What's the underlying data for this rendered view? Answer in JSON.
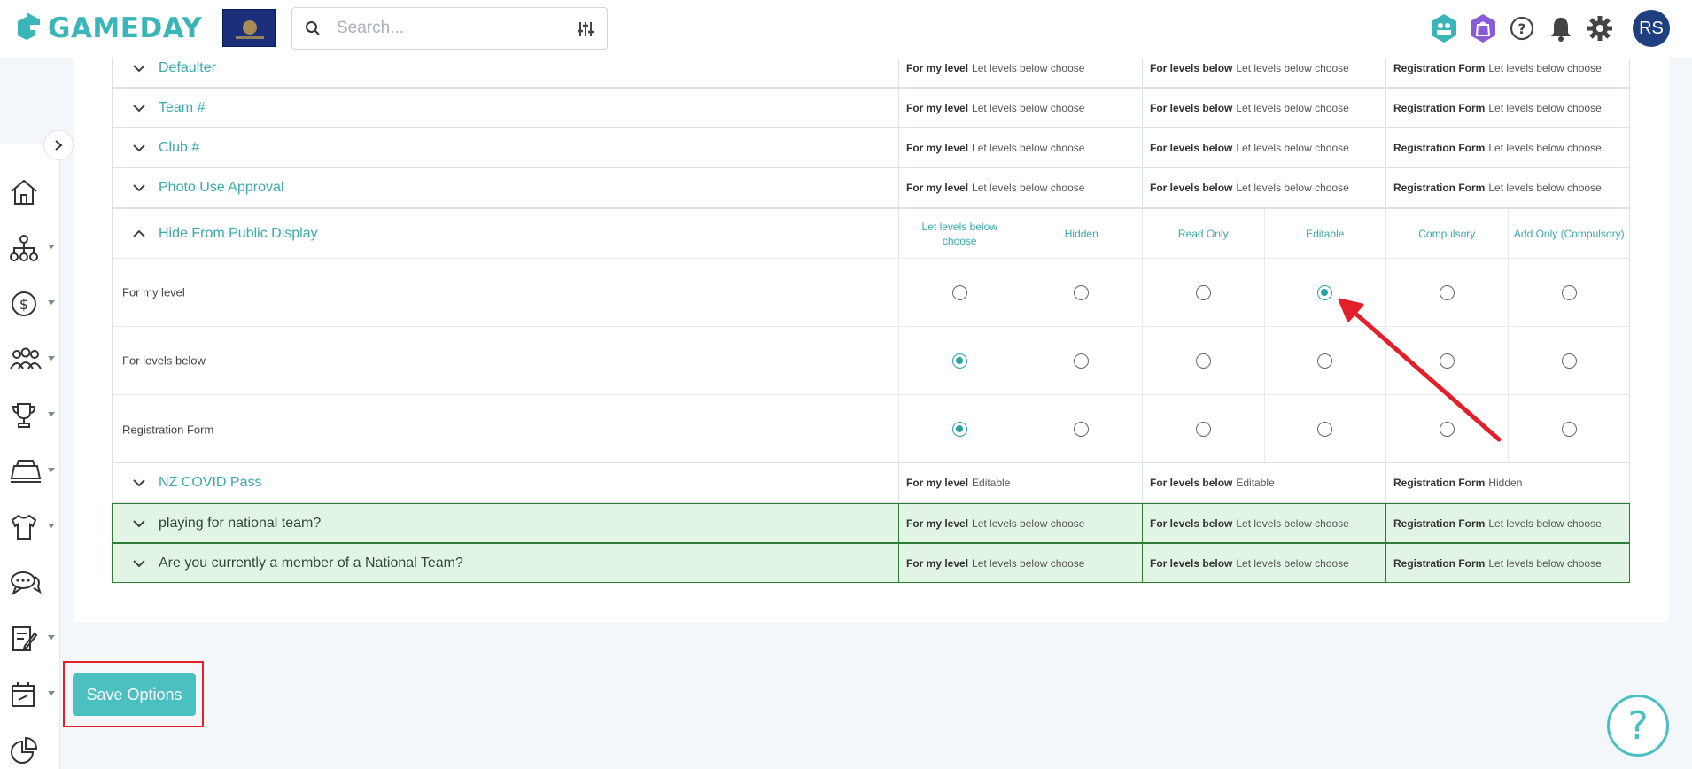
{
  "header": {
    "brand": "GAMEDAY",
    "search_placeholder": "Search...",
    "avatar_initials": "RS",
    "colors": {
      "brand": "#3ab6b8",
      "accent": "#4bc0c3",
      "avatar": "#1e3f80"
    }
  },
  "sidebar": {
    "items": [
      "home-icon",
      "org-chart-icon",
      "dollar-icon",
      "people-icon",
      "trophy-icon",
      "venue-icon",
      "jersey-icon",
      "chat-icon",
      "form-icon",
      "calendar-icon",
      "pie-chart-icon"
    ]
  },
  "rows_top": [
    {
      "name": "Defaulter",
      "s1_label": "For my level",
      "s1_value": "Let levels below choose",
      "s2_label": "For levels below",
      "s2_value": "Let levels below choose",
      "s3_label": "Registration Form",
      "s3_value": "Let levels below choose"
    },
    {
      "name": "Team #",
      "s1_label": "For my level",
      "s1_value": "Let levels below choose",
      "s2_label": "For levels below",
      "s2_value": "Let levels below choose",
      "s3_label": "Registration Form",
      "s3_value": "Let levels below choose"
    },
    {
      "name": "Club #",
      "s1_label": "For my level",
      "s1_value": "Let levels below choose",
      "s2_label": "For levels below",
      "s2_value": "Let levels below choose",
      "s3_label": "Registration Form",
      "s3_value": "Let levels below choose"
    },
    {
      "name": "Photo Use Approval",
      "s1_label": "For my level",
      "s1_value": "Let levels below choose",
      "s2_label": "For levels below",
      "s2_value": "Let levels below choose",
      "s3_label": "Registration Form",
      "s3_value": "Let levels below choose"
    }
  ],
  "expanded": {
    "name": "Hide From Public Display",
    "columns": [
      "Let levels below choose",
      "Hidden",
      "Read Only",
      "Editable",
      "Compulsory",
      "Add Only (Compulsory)"
    ],
    "rows": [
      {
        "label": "For my level",
        "selected": 3
      },
      {
        "label": "For levels below",
        "selected": 0
      },
      {
        "label": "Registration Form",
        "selected": 0
      }
    ]
  },
  "rows_bottom": [
    {
      "name": "NZ COVID Pass",
      "s1_label": "For my level",
      "s1_value": "Editable",
      "s2_label": "For levels below",
      "s2_value": "Editable",
      "s3_label": "Registration Form",
      "s3_value": "Hidden"
    },
    {
      "name": "playing for national team?",
      "s1_label": "For my level",
      "s1_value": "Let levels below choose",
      "s2_label": "For levels below",
      "s2_value": "Let levels below choose",
      "s3_label": "Registration Form",
      "s3_value": "Let levels below choose"
    },
    {
      "name": "Are you currently a member of a National Team?",
      "s1_label": "For my level",
      "s1_value": "Let levels below choose",
      "s2_label": "For levels below",
      "s2_value": "Let levels below choose",
      "s3_label": "Registration Form",
      "s3_value": "Let levels below choose"
    }
  ],
  "save_label": "Save Options",
  "help_label": "?"
}
